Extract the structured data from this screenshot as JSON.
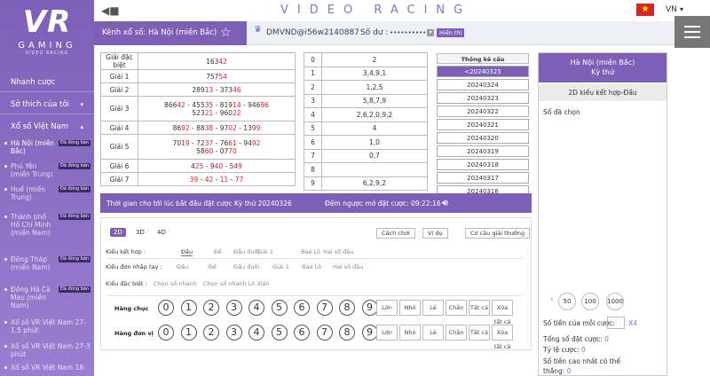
{
  "brand": {
    "logo": "VR",
    "name": "GAMING",
    "tagline": "VIDEO RACING"
  },
  "header": {
    "title": "VIDEO RACING",
    "lang": "VN",
    "flag": "★"
  },
  "subbar": {
    "channel": "Kênh xổ số: Hà Nội (miền Bắc)",
    "user": "DMVND@i56w2140887",
    "balance_label": "Số dư :",
    "balance_value": "••••••••••",
    "show_label": "Hiển thị"
  },
  "sidebar": {
    "menu": [
      "Nhanh cược",
      "Sở thích của tôi",
      "Xổ số Việt Nam"
    ],
    "subitems": [
      {
        "label": "Hà Nội (miền Bắc)",
        "badge": "Đã đóng bán"
      },
      {
        "label": "Phú Yên (miền Trung)",
        "badge": "Đã đóng bán"
      },
      {
        "label": "Huế (miền Trung)",
        "badge": "Đã đóng bán"
      },
      {
        "label": "Thành phố Hồ Chí Minh (miền Nam)",
        "badge": "Đã đóng bán"
      },
      {
        "label": "Đồng Tháp (miền Nam)",
        "badge": "Đã đóng bán"
      },
      {
        "label": "Đồng Hà Cà Mau (miền Nam)",
        "badge": "Đã đóng bán"
      },
      {
        "label": "Xổ số VR Việt Nam 27-1.5 phút",
        "badge": ""
      },
      {
        "label": "Xổ số VR Việt Nam 27-3 phút",
        "badge": ""
      },
      {
        "label": "Xổ số VR Việt Nam 18-",
        "badge": ""
      }
    ]
  },
  "results": {
    "rows": [
      {
        "prize": "Giải đặc biệt",
        "lines": [
          [
            [
              "163",
              ""
            ],
            [
              "42",
              "r"
            ]
          ]
        ]
      },
      {
        "prize": "Giải 1",
        "lines": [
          [
            [
              "757",
              ""
            ],
            [
              "54",
              "r"
            ]
          ]
        ]
      },
      {
        "prize": "Giải 2",
        "lines": [
          [
            [
              "289",
              ""
            ],
            [
              "13",
              "r"
            ],
            [
              " - 373",
              ""
            ],
            [
              "46",
              "r"
            ]
          ]
        ]
      },
      {
        "prize": "Giải 3",
        "lines": [
          [
            [
              "866",
              ""
            ],
            [
              "42",
              "r"
            ],
            [
              " - 455",
              ""
            ],
            [
              "35",
              "r"
            ],
            [
              " - 819",
              ""
            ],
            [
              "14",
              "r"
            ],
            [
              " - 946",
              ""
            ],
            [
              "96",
              "r"
            ]
          ],
          [
            [
              "523",
              ""
            ],
            [
              "21",
              "r"
            ],
            [
              " - 960",
              ""
            ],
            [
              "22",
              "r"
            ]
          ]
        ]
      },
      {
        "prize": "Giải 4",
        "lines": [
          [
            [
              "86",
              ""
            ],
            [
              "92",
              "r"
            ],
            [
              " - 88",
              ""
            ],
            [
              "38",
              "r"
            ],
            [
              " - 97",
              ""
            ],
            [
              "02",
              "r"
            ],
            [
              " - 13",
              ""
            ],
            [
              "99",
              "r"
            ]
          ]
        ]
      },
      {
        "prize": "Giải 5",
        "lines": [
          [
            [
              "70",
              ""
            ],
            [
              "19",
              "r"
            ],
            [
              " - 72",
              ""
            ],
            [
              "37",
              "r"
            ],
            [
              " - 76",
              ""
            ],
            [
              "61",
              "r"
            ],
            [
              " - 94",
              ""
            ],
            [
              "92",
              "r"
            ]
          ],
          [
            [
              "58",
              ""
            ],
            [
              "60",
              "r"
            ],
            [
              " - 07",
              ""
            ],
            [
              "70",
              "r"
            ]
          ]
        ]
      },
      {
        "prize": "Giải 6",
        "lines": [
          [
            [
              "4",
              ""
            ],
            [
              "25",
              "r"
            ],
            [
              " - 9",
              ""
            ],
            [
              "40",
              "r"
            ],
            [
              " - 5",
              ""
            ],
            [
              "49",
              "r"
            ]
          ]
        ]
      },
      {
        "prize": "Giải 7",
        "lines": [
          [
            [
              "39",
              "r"
            ],
            [
              " - ",
              ""
            ],
            [
              "42",
              "r"
            ],
            [
              " - ",
              ""
            ],
            [
              "11",
              "r"
            ],
            [
              " - ",
              ""
            ],
            [
              "77",
              "r"
            ]
          ]
        ]
      }
    ]
  },
  "stats": [
    [
      "0",
      "2"
    ],
    [
      "1",
      "3,4,9,1"
    ],
    [
      "2",
      "1,2,5"
    ],
    [
      "3",
      "5,8,7,9"
    ],
    [
      "4",
      "2,6,2,0,9,2"
    ],
    [
      "5",
      "4"
    ],
    [
      "6",
      "1,0"
    ],
    [
      "7",
      "0,7"
    ],
    [
      "8",
      ""
    ],
    [
      "9",
      "6,2,9,2"
    ]
  ],
  "dates": {
    "header": "Thống kê cầu",
    "items": [
      "<20240325",
      "20240324",
      "20240323",
      "20240322",
      "20240321",
      "20240320",
      "20240319",
      "20240318",
      "20240317",
      "20240316"
    ]
  },
  "countdown": {
    "text": "Thời gian cho tới lúc bắt đầu đặt cược Kỳ thứ 20240326",
    "timer": "Đếm ngược mở đặt cược: 09:22:16"
  },
  "bet": {
    "tabs": [
      "2D",
      "3D",
      "4D"
    ],
    "buttons": [
      "Cách chơi",
      "Ví dụ",
      "Cơ cấu giải thưởng"
    ],
    "rows": [
      {
        "label": "Kiểu kết hợp :",
        "opts": [
          "Đầu",
          "Đề",
          "Đầu đuôi",
          "Giải 1",
          "Bao Lô",
          "Hai số đầu"
        ]
      },
      {
        "label": "Kiểu đơn nhập tay :",
        "opts": [
          "Đầu",
          "Đề",
          "Đầu đuôi",
          "Giải 1",
          "Bao Lô",
          "Hai số đầu"
        ]
      },
      {
        "label": "Kiểu đặc biệt :",
        "opts": [
          "Chọn số nhanh",
          "Chọn số nhanh Lô Xiên"
        ]
      }
    ],
    "row_chuc": "Hàng chục",
    "row_donvi": "Hàng đơn vị",
    "digits": [
      "0",
      "1",
      "2",
      "3",
      "4",
      "5",
      "6",
      "7",
      "8",
      "9"
    ],
    "quick": [
      "Lớn",
      "Nhỏ",
      "Lẻ",
      "Chẵn",
      "Tất cả",
      "Xóa tất cả"
    ]
  },
  "right": {
    "title1": "Hà Nội (miền Bắc)",
    "title2": "Kỳ thứ",
    "type": "2D kiểu kết hợp-Đầu",
    "chosen": "Số đã chọn",
    "amounts": [
      "50",
      "100",
      "1000"
    ],
    "per_bet": "Số tiền của mỗi cược:",
    "mult": "X4",
    "total_label": "Tổng số đặt cược:",
    "total": "0",
    "rate_label": "Tỷ lệ cược:",
    "rate": "0",
    "max_label": "Số tiền cao nhất có thể thắng:",
    "max": "0"
  },
  "colors": {
    "accent": "#7d5fb8",
    "red": "#d22222"
  }
}
